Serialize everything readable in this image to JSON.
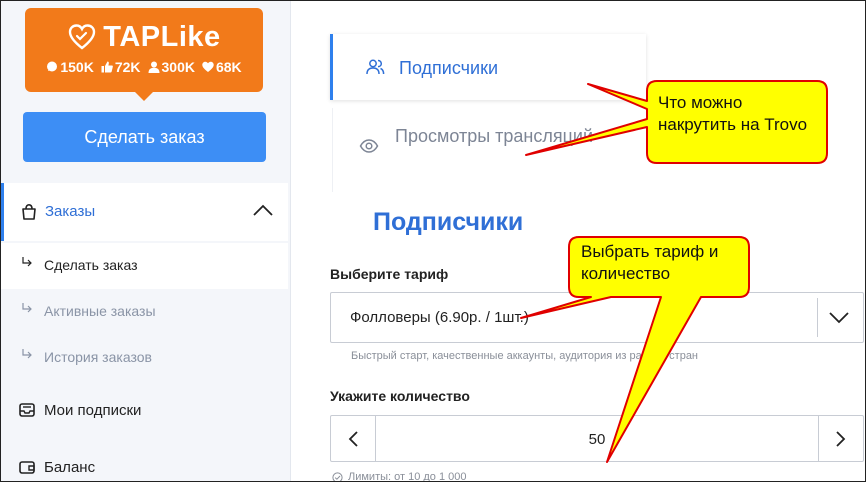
{
  "logo": {
    "name": "TAPLike",
    "stats": [
      {
        "icon": "comment-icon",
        "value": "150K"
      },
      {
        "icon": "thumbs-up-icon",
        "value": "72K"
      },
      {
        "icon": "user-icon",
        "value": "300K"
      },
      {
        "icon": "heart-icon",
        "value": "68K"
      }
    ]
  },
  "sidebar": {
    "order_button": "Сделать заказ",
    "orders_group": {
      "label": "Заказы",
      "icon": "shopping-bag-icon"
    },
    "order_items": [
      {
        "label": "Сделать заказ",
        "active": true
      },
      {
        "label": "Активные заказы",
        "active": false
      },
      {
        "label": "История заказов",
        "active": false
      }
    ],
    "nav": [
      {
        "label": "Мои подписки",
        "icon": "inbox-icon"
      },
      {
        "label": "Баланс",
        "icon": "wallet-icon"
      }
    ]
  },
  "main": {
    "tabs": [
      {
        "label": "Подписчики",
        "icon": "users-icon",
        "active": true
      },
      {
        "label": "Просмотры трансляций",
        "icon": "eye-icon",
        "active": false
      }
    ],
    "section_title": "Подписчики",
    "tariff": {
      "label": "Выберите тариф",
      "value": "Фолловеры (6.90р. / 1шт.)",
      "hint": "Быстрый старт, качественные аккаунты, аудитория из разных стран"
    },
    "quantity": {
      "label": "Укажите количество",
      "value": "50",
      "limits": "Лимиты: от 10 до 1 000"
    }
  },
  "annotations": [
    {
      "text": "Что можно накрутить на Trovo"
    },
    {
      "text": "Выбрать тариф и количество"
    }
  ],
  "colors": {
    "brand_orange": "#f27a1a",
    "accent_blue": "#3d8ef5",
    "link_blue": "#2f6fd6",
    "callout_yellow": "#ffff00",
    "callout_border": "#e00000"
  }
}
